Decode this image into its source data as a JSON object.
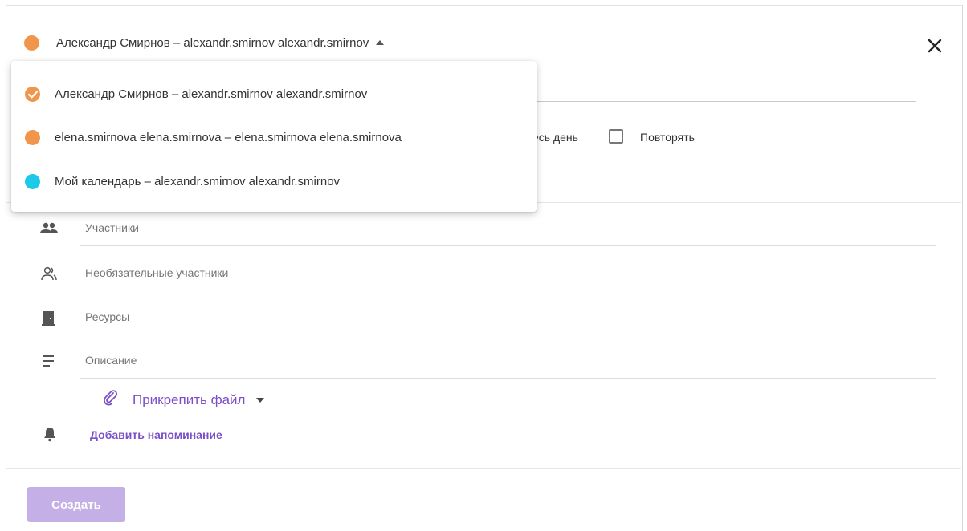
{
  "colors": {
    "accent": "#7a4fc8",
    "orange_dot": "#f0954a",
    "cyan_dot": "#1cc9e8",
    "create_disabled": "#c4b0e6"
  },
  "calendar_selector": {
    "label": "Александр Смирнов – alexandr.smirnov alexandr.smirnov",
    "expanded": true
  },
  "calendar_dropdown": {
    "options": [
      {
        "label": "Александр Смирнов – alexandr.smirnov alexandr.smirnov",
        "color": "#f0954a",
        "selected": true
      },
      {
        "label": "elena.smirnova elena.smirnova – elena.smirnova elena.smirnova",
        "color": "#f0954a",
        "selected": false
      },
      {
        "label": "Мой календарь – alexandr.smirnov alexandr.smirnov",
        "color": "#1cc9e8",
        "selected": false
      }
    ]
  },
  "options_row": {
    "all_day_partial": "есь день",
    "repeat_label": "Повторять",
    "repeat_checked": false
  },
  "fields": {
    "participants_placeholder": "Участники",
    "optional_participants_placeholder": "Необязательные участники",
    "resources_placeholder": "Ресурсы",
    "description_placeholder": "Описание"
  },
  "attach": {
    "label": "Прикрепить файл"
  },
  "reminder": {
    "label": "Добавить напоминание"
  },
  "actions": {
    "create_label": "Создать"
  },
  "icons": {
    "close": "close-icon",
    "participants": "people-icon",
    "optional_participants": "people-outline-icon",
    "resources": "door-icon",
    "description": "text-lines-icon",
    "attach": "paperclip-icon",
    "reminder": "bell-icon"
  }
}
